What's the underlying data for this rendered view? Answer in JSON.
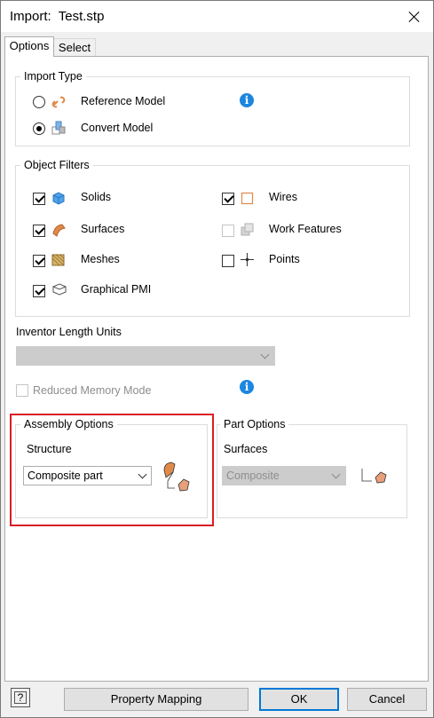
{
  "window": {
    "title": "Import:  Test.stp"
  },
  "tabs": [
    {
      "label": "Options"
    },
    {
      "label": "Select"
    }
  ],
  "import_type": {
    "legend": "Import Type",
    "options": [
      {
        "label": "Reference Model",
        "selected": false,
        "icon": "link-icon"
      },
      {
        "label": "Convert Model",
        "selected": true,
        "icon": "convert-model-icon"
      }
    ]
  },
  "object_filters": {
    "legend": "Object Filters",
    "items": [
      {
        "label": "Solids",
        "checked": true,
        "enabled": true,
        "icon": "solid-cube-icon"
      },
      {
        "label": "Surfaces",
        "checked": true,
        "enabled": true,
        "icon": "surface-icon"
      },
      {
        "label": "Meshes",
        "checked": true,
        "enabled": true,
        "icon": "mesh-icon"
      },
      {
        "label": "Graphical PMI",
        "checked": true,
        "enabled": true,
        "icon": "pmi-icon"
      },
      {
        "label": "Wires",
        "checked": true,
        "enabled": true,
        "icon": "wire-icon"
      },
      {
        "label": "Work Features",
        "checked": false,
        "enabled": false,
        "icon": "work-features-icon"
      },
      {
        "label": "Points",
        "checked": false,
        "enabled": true,
        "icon": "point-icon"
      }
    ]
  },
  "length_units": {
    "label": "Inventor Length Units",
    "value": ""
  },
  "reduced_memory": {
    "label": "Reduced Memory Mode",
    "checked": false,
    "enabled": false
  },
  "assembly_options": {
    "legend": "Assembly Options",
    "structure_label": "Structure",
    "structure_value": "Composite part"
  },
  "part_options": {
    "legend": "Part Options",
    "surfaces_label": "Surfaces",
    "surfaces_value": "Composite"
  },
  "footer": {
    "help_label": "?",
    "property_mapping": "Property Mapping",
    "ok": "OK",
    "cancel": "Cancel"
  },
  "colors": {
    "accent": "#1c86e0",
    "highlight": "#d81e24",
    "icon_orange": "#e08a4a"
  }
}
